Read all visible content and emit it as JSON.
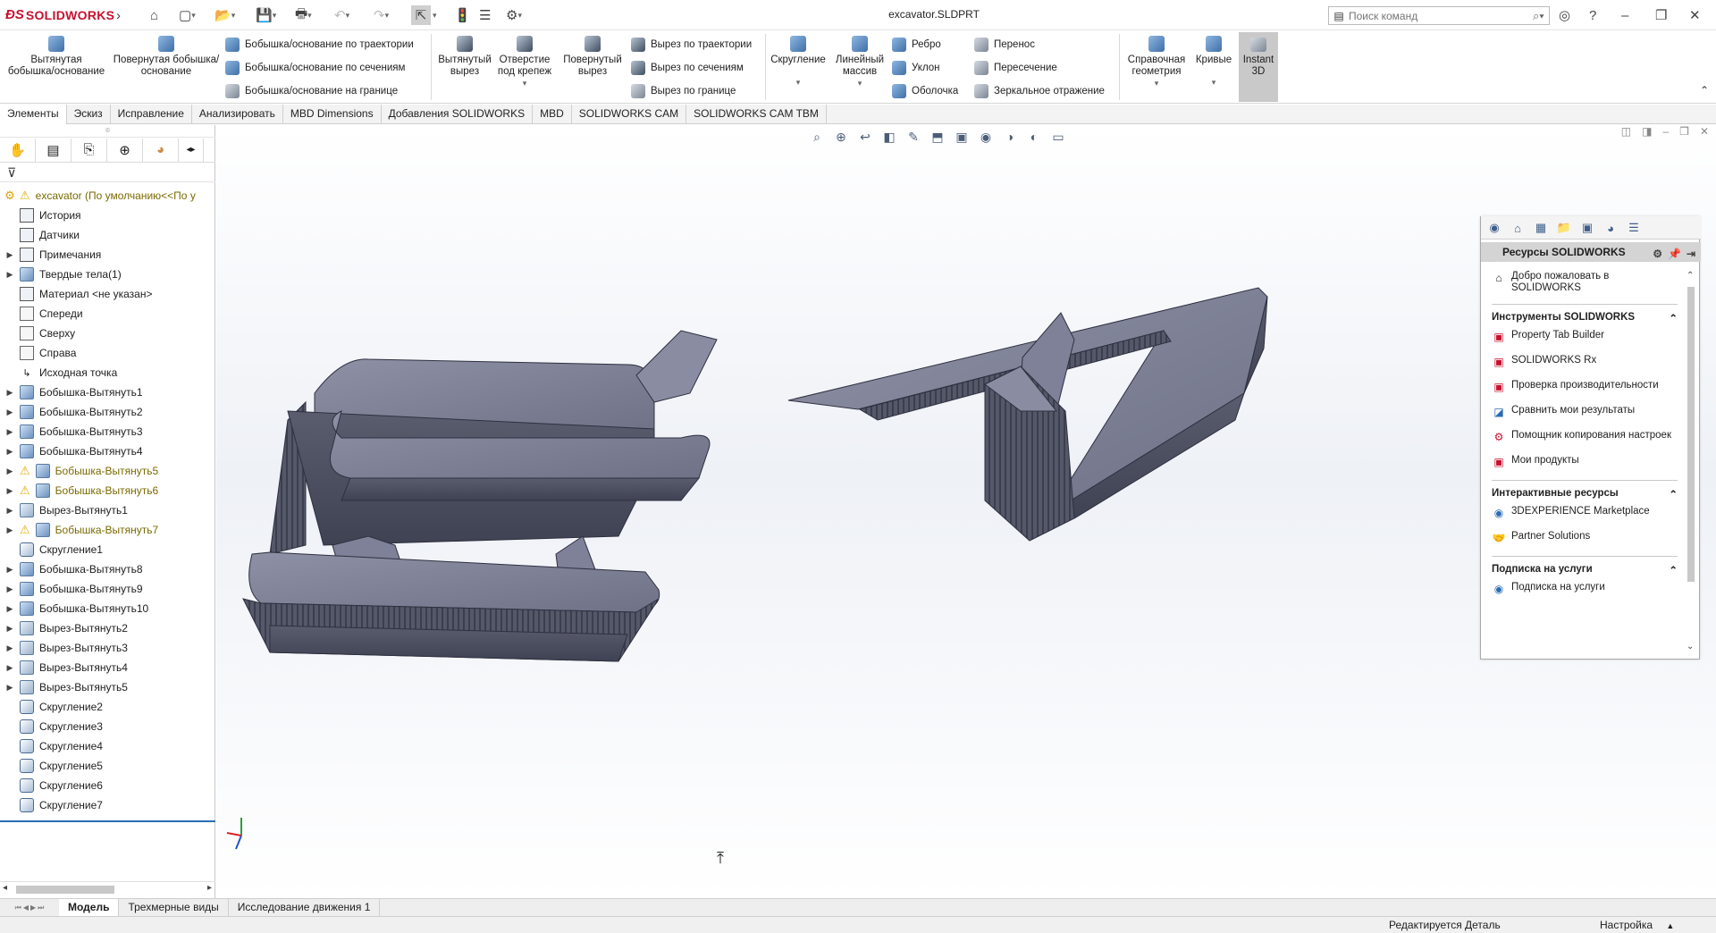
{
  "app": {
    "brand": "SOLIDWORKS",
    "doc_title": "excavator.SLDPRT"
  },
  "search": {
    "placeholder": "Поиск команд"
  },
  "ribbon": {
    "extruded_boss": "Вытянутая бобышка/основание",
    "revolved_boss": "Повернутая бобышка/основание",
    "swept_boss": "Бобышка/основание по траектории",
    "lofted_boss": "Бобышка/основание по сечениям",
    "boundary_boss": "Бобышка/основание на границе",
    "extruded_cut": "Вытянутый вырез",
    "hole_wizard": "Отверстие под крепеж",
    "revolved_cut": "Повернутый вырез",
    "swept_cut": "Вырез по траектории",
    "lofted_cut": "Вырез по сечениям",
    "boundary_cut": "Вырез по границе",
    "fillet": "Скругление",
    "linear_pattern": "Линейный массив",
    "rib": "Ребро",
    "draft": "Уклон",
    "shell": "Оболочка",
    "wrap": "Перенос",
    "intersect": "Пересечение",
    "mirror": "Зеркальное отражение",
    "ref_geometry": "Справочная геометрия",
    "curves": "Кривые",
    "instant3d": "Instant 3D"
  },
  "tabs": [
    "Элементы",
    "Эскиз",
    "Исправление",
    "Анализировать",
    "MBD Dimensions",
    "Добавления SOLIDWORKS",
    "MBD",
    "SOLIDWORKS CAM",
    "SOLIDWORKS CAM TBM"
  ],
  "tree": {
    "root": "excavator  (По умолчанию<<По у",
    "items": [
      {
        "label": "История",
        "icon": "history-icon"
      },
      {
        "label": "Датчики",
        "icon": "sensors-icon"
      },
      {
        "label": "Примечания",
        "icon": "annotations-icon"
      },
      {
        "label": "Твердые тела(1)",
        "icon": "solid-bodies-icon"
      },
      {
        "label": "Материал <не указан>",
        "icon": "material-icon"
      },
      {
        "label": "Спереди",
        "icon": "plane-icon"
      },
      {
        "label": "Сверху",
        "icon": "plane-icon"
      },
      {
        "label": "Справа",
        "icon": "plane-icon"
      },
      {
        "label": "Исходная точка",
        "icon": "origin-icon"
      },
      {
        "label": "Бобышка-Вытянуть1",
        "icon": "extrude-icon"
      },
      {
        "label": "Бобышка-Вытянуть2",
        "icon": "extrude-icon"
      },
      {
        "label": "Бобышка-Вытянуть3",
        "icon": "extrude-icon"
      },
      {
        "label": "Бобышка-Вытянуть4",
        "icon": "extrude-icon"
      },
      {
        "label": "Бобышка-Вытянуть5",
        "icon": "extrude-icon"
      },
      {
        "label": "Бобышка-Вытянуть6",
        "icon": "extrude-icon"
      },
      {
        "label": "Вырез-Вытянуть1",
        "icon": "cut-icon"
      },
      {
        "label": "Бобышка-Вытянуть7",
        "icon": "extrude-icon"
      },
      {
        "label": "Скругление1",
        "icon": "fillet-icon"
      },
      {
        "label": "Бобышка-Вытянуть8",
        "icon": "extrude-icon"
      },
      {
        "label": "Бобышка-Вытянуть9",
        "icon": "extrude-icon"
      },
      {
        "label": "Бобышка-Вытянуть10",
        "icon": "extrude-icon"
      },
      {
        "label": "Вырез-Вытянуть2",
        "icon": "cut-icon"
      },
      {
        "label": "Вырез-Вытянуть3",
        "icon": "cut-icon"
      },
      {
        "label": "Вырез-Вытянуть4",
        "icon": "cut-icon"
      },
      {
        "label": "Вырез-Вытянуть5",
        "icon": "cut-icon"
      },
      {
        "label": "Скругление2",
        "icon": "fillet-icon"
      },
      {
        "label": "Скругление3",
        "icon": "fillet-icon"
      },
      {
        "label": "Скругление4",
        "icon": "fillet-icon"
      },
      {
        "label": "Скругление5",
        "icon": "fillet-icon"
      },
      {
        "label": "Скругление6",
        "icon": "fillet-icon"
      },
      {
        "label": "Скругление7",
        "icon": "fillet-icon"
      }
    ]
  },
  "taskpane": {
    "title": "Ресурсы SOLIDWORKS",
    "welcome": "Добро пожаловать в SOLIDWORKS",
    "tools_header": "Инструменты SOLIDWORKS",
    "tools": [
      "Property Tab Builder",
      "SOLIDWORKS Rx",
      "Проверка производительности",
      "Сравнить мои результаты",
      "Помощник копирования настроек",
      "Мои продукты"
    ],
    "online_header": "Интерактивные ресурсы",
    "online": [
      "3DEXPERIENCE Marketplace",
      "Partner Solutions"
    ],
    "subscription_header": "Подписка на услуги",
    "subscription": [
      "Подписка на услуги"
    ]
  },
  "bottom_tabs": [
    "Модель",
    "Трехмерные виды",
    "Исследование движения 1"
  ],
  "status": {
    "editing": "Редактируется Деталь",
    "custom": "Настройка"
  },
  "colors": {
    "brand": "#c8102e",
    "model_face": "#6c6f82",
    "accent": "#2b6cb3"
  }
}
